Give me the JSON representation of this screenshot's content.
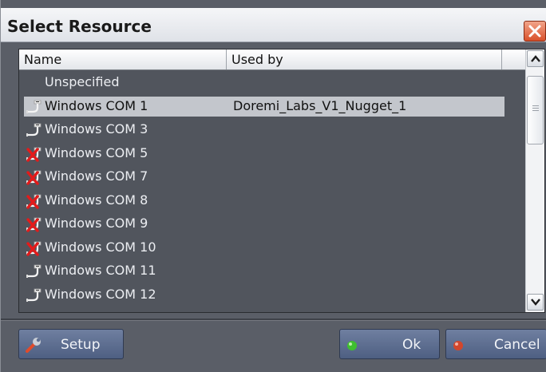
{
  "window": {
    "title": "Select Resource",
    "close_icon": "close-x-icon"
  },
  "table": {
    "columns": [
      "Name",
      "Used by"
    ],
    "rows": [
      {
        "name": "Unspecified",
        "used_by": "",
        "icon": "none",
        "selected": false
      },
      {
        "name": "Windows COM 1",
        "used_by": "Doremi_Labs_V1_Nugget_1",
        "icon": "serial-cable-icon",
        "selected": true
      },
      {
        "name": "Windows COM 3",
        "used_by": "",
        "icon": "serial-cable-icon",
        "selected": false
      },
      {
        "name": "Windows COM 5",
        "used_by": "",
        "icon": "serial-cable-unavailable-icon",
        "selected": false
      },
      {
        "name": "Windows COM 7",
        "used_by": "",
        "icon": "serial-cable-unavailable-icon",
        "selected": false
      },
      {
        "name": "Windows COM 8",
        "used_by": "",
        "icon": "serial-cable-unavailable-icon",
        "selected": false
      },
      {
        "name": "Windows COM 9",
        "used_by": "",
        "icon": "serial-cable-unavailable-icon",
        "selected": false
      },
      {
        "name": "Windows COM 10",
        "used_by": "",
        "icon": "serial-cable-unavailable-icon",
        "selected": false
      },
      {
        "name": "Windows COM 11",
        "used_by": "",
        "icon": "serial-cable-icon",
        "selected": false
      },
      {
        "name": "Windows COM 12",
        "used_by": "",
        "icon": "serial-cable-icon",
        "selected": false
      }
    ]
  },
  "buttons": {
    "setup": {
      "label": "Setup",
      "icon": "wrench-icon"
    },
    "ok": {
      "label": "Ok",
      "icon": "green-status-dot-icon"
    },
    "cancel": {
      "label": "Cancel",
      "icon": "red-status-dot-icon"
    }
  },
  "colors": {
    "background": "#5a5e67",
    "selected_row": "#c3c6cc",
    "button": "#5e6f92",
    "ok_dot": "#3fbf2f",
    "cancel_dot": "#d2462c"
  }
}
